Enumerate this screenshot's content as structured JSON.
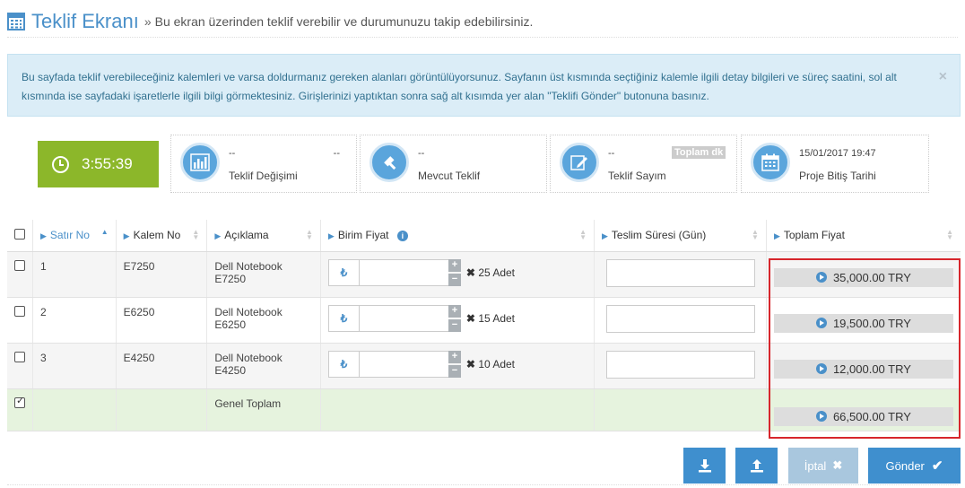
{
  "header": {
    "title": "Teklif Ekranı",
    "separator": "»",
    "subtitle": "Bu ekran üzerinden teklif verebilir ve durumunuzu takip edebilirsiniz."
  },
  "alert": {
    "text": "Bu sayfada teklif verebileceğiniz kalemleri ve varsa doldurmanız gereken alanları görüntülüyorsunuz. Sayfanın üst kısmında seçtiğiniz kalemle ilgili detay bilgileri ve süreç saatini, sol alt kısmında ise sayfadaki işaretlerle ilgili bilgi görmektesiniz. Girişlerinizi yaptıktan sonra sağ alt kısımda yer alan \"Teklifi Gönder\" butonuna basınız.",
    "close": "×"
  },
  "timer": {
    "value": "3:55:39"
  },
  "stats": {
    "teklif_degisimi": {
      "value": "--",
      "value2": "--",
      "label": "Teklif Değişimi"
    },
    "mevcut_teklif": {
      "value": "--",
      "label": "Mevcut Teklif"
    },
    "teklif_sayim": {
      "value": "--",
      "tag": "Toplam dk",
      "label": "Teklif Sayım"
    },
    "proje_bitis": {
      "value": "15/01/2017 19:47",
      "label": "Proje Bitiş Tarihi"
    }
  },
  "table": {
    "headers": {
      "satir_no": "Satır No",
      "kalem_no": "Kalem No",
      "aciklama": "Açıklama",
      "birim_fiyat": "Birim Fiyat",
      "teslim_suresi": "Teslim Süresi (Gün)",
      "toplam_fiyat": "Toplam Fiyat"
    },
    "rows": [
      {
        "satir": "1",
        "kalem": "E7250",
        "aciklama1": "Dell Notebook",
        "aciklama2": "E7250",
        "currency": "₺",
        "adet": "25 Adet",
        "toplam": "35,000.00 TRY"
      },
      {
        "satir": "2",
        "kalem": "E6250",
        "aciklama1": "Dell Notebook",
        "aciklama2": "E6250",
        "currency": "₺",
        "adet": "15 Adet",
        "toplam": "19,500.00 TRY"
      },
      {
        "satir": "3",
        "kalem": "E4250",
        "aciklama1": "Dell Notebook",
        "aciklama2": "E4250",
        "currency": "₺",
        "adet": "10 Adet",
        "toplam": "12,000.00 TRY"
      }
    ],
    "total": {
      "label": "Genel Toplam",
      "value": "66,500.00 TRY"
    }
  },
  "buttons": {
    "iptal": "İptal",
    "gonder": "Gönder"
  },
  "colors": {
    "accent": "#4a90c9",
    "timer": "#8cb72a",
    "highlight": "#d7262c",
    "total_row": "#e6f3de"
  }
}
